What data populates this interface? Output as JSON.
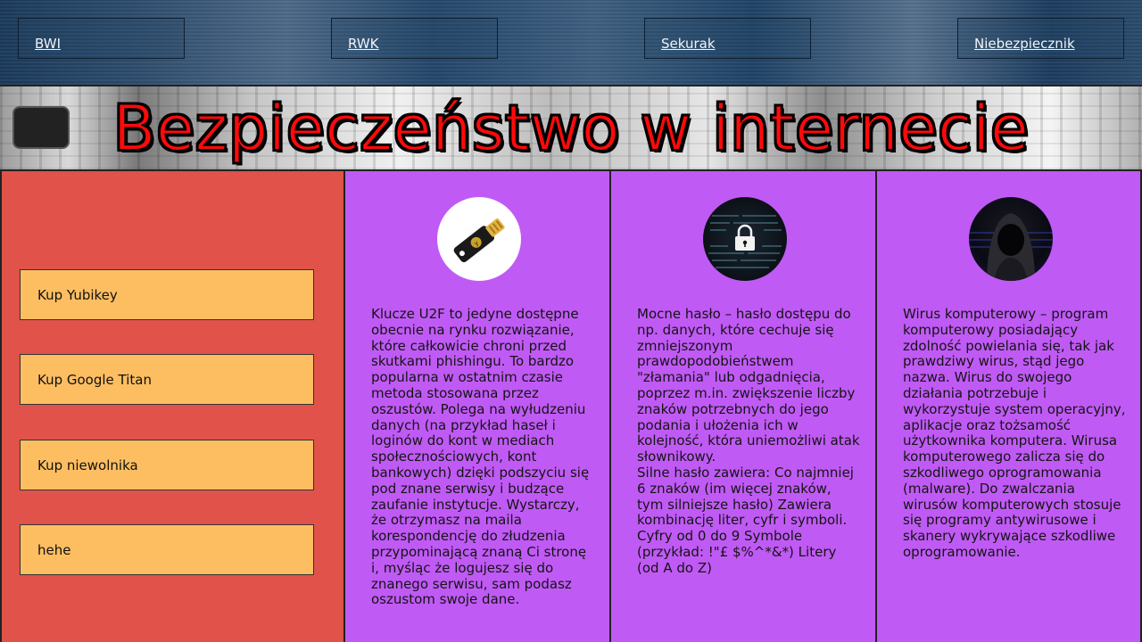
{
  "nav": {
    "links": [
      "BWI",
      "RWK",
      "Sekurak",
      "Niebezpiecznik"
    ]
  },
  "banner": {
    "title": "Bezpieczeństwo w internecie"
  },
  "sidebar": {
    "buttons": [
      "Kup Yubikey",
      "Kup Google Titan",
      "Kup niewolnika",
      "hehe"
    ]
  },
  "columns": [
    {
      "icon": "usb-security-key-icon",
      "text": "Klucze U2F to jedyne dostępne obecnie na rynku rozwiązanie, które całkowicie chroni przed skutkami phishingu. To bardzo popularna w ostatnim czasie metoda stosowana przez oszustów. Polega na wyłudzeniu danych (na przykład haseł i loginów do kont w mediach społecznościowych, kont bankowych) dzięki podszyciu się pod znane serwisy i budzące zaufanie instytucje. Wystarczy, że otrzymasz na maila korespondencję do złudzenia przypominającą znaną Ci stronę i, myśląc że logujesz się do znanego serwisu, sam podasz oszustom swoje dane."
    },
    {
      "icon": "padlock-icon",
      "text": "Mocne hasło – hasło dostępu do np. danych, które cechuje się zmniejszonym prawdopodobieństwem \"złamania\" lub odgadnięcia, poprzez m.in. zwiększenie liczby znaków potrzebnych do jego podania i ułożenia ich w kolejność, która uniemożliwi atak słownikowy.\nSilne hasło zawiera: Co najmniej 6 znaków (im więcej znaków, tym silniejsze hasło) Zawiera kombinację liter, cyfr i symboli. Cyfry od 0 do 9 Symbole (przykład: !\"£ $%^*&*) Litery (od A do Z)"
    },
    {
      "icon": "hooded-hacker-icon",
      "text": "Wirus komputerowy – program komputerowy posiadający zdolność powielania się, tak jak prawdziwy wirus, stąd jego nazwa. Wirus do swojego działania potrzebuje i wykorzystuje system operacyjny, aplikacje oraz tożsamość użytkownika komputera. Wirusa komputerowego zalicza się do szkodliwego oprogramowania (malware). Do zwalczania wirusów komputerowych stosuje się programy antywirusowe i skanery wykrywające szkodliwe oprogramowanie."
    }
  ]
}
